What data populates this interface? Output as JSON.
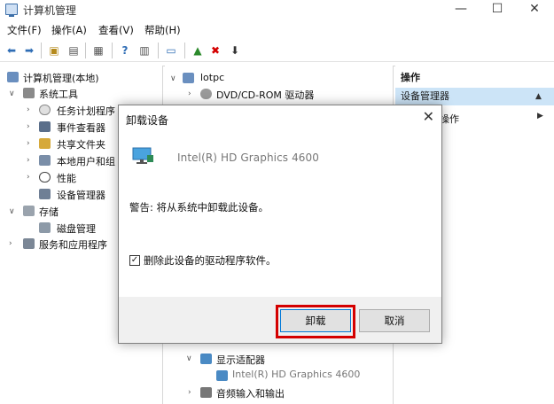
{
  "window": {
    "title": "计算机管理"
  },
  "menu": [
    {
      "label": "文件(F)"
    },
    {
      "label": "操作(A)"
    },
    {
      "label": "查看(V)"
    },
    {
      "label": "帮助(H)"
    }
  ],
  "tree": {
    "root": "计算机管理(本地)",
    "system_tools": "系统工具",
    "task_scheduler": "任务计划程序",
    "event_viewer": "事件查看器",
    "shared_folders": "共享文件夹",
    "local_users": "本地用户和组",
    "performance": "性能",
    "device_manager": "设备管理器",
    "storage": "存储",
    "disk_management": "磁盘管理",
    "services_apps": "服务和应用程序"
  },
  "devices": {
    "computer": "lotpc",
    "dvd": "DVD/CD-ROM 驱动器",
    "display_adapters": "显示适配器",
    "gpu": "Intel(R) HD Graphics 4600",
    "audio": "音频输入和输出"
  },
  "actions": {
    "header": "操作",
    "selected": "设备管理器",
    "more": "操作"
  },
  "dialog": {
    "title": "卸载设备",
    "device_name": "Intel(R) HD Graphics 4600",
    "warning": "警告: 将从系统中卸载此设备。",
    "checkbox_label": "删除此设备的驱动程序软件。",
    "checkbox_checked": true,
    "uninstall_label": "卸载",
    "cancel_label": "取消"
  },
  "colors": {
    "selection": "#cce4f7",
    "highlight_box": "#d40000",
    "accent": "#0078d7"
  }
}
